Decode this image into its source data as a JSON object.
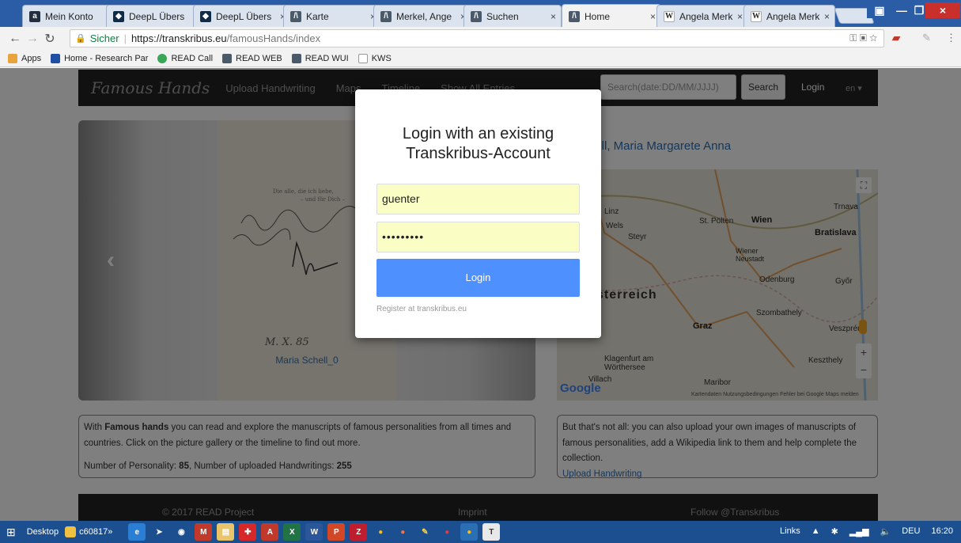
{
  "browser": {
    "tabs": [
      {
        "title": "Mein Konto",
        "icon": "amazon-icon",
        "color": "#232f3e"
      },
      {
        "title": "DeepL Übers",
        "icon": "deepl-icon",
        "color": "#0f2b46"
      },
      {
        "title": "DeepL Übers",
        "icon": "deepl-icon",
        "color": "#0f2b46"
      },
      {
        "title": "Karte",
        "icon": "transkribus-icon",
        "color": "#4a5a6a"
      },
      {
        "title": "Merkel, Ange",
        "icon": "transkribus-icon",
        "color": "#4a5a6a"
      },
      {
        "title": "Suchen",
        "icon": "transkribus-icon",
        "color": "#4a5a6a"
      },
      {
        "title": "Home",
        "icon": "transkribus-icon",
        "color": "#4a5a6a"
      },
      {
        "title": "Angela Merk",
        "icon": "wikipedia-icon",
        "color": "#ffffff"
      },
      {
        "title": "Angela Merk",
        "icon": "wikipedia-icon",
        "color": "#ffffff"
      }
    ],
    "secure_label": "Sicher",
    "url_host": "https://transkribus.eu",
    "url_path": "/famousHands/index",
    "bookmarks": [
      {
        "label": "Apps",
        "color": "#e8a33d"
      },
      {
        "label": "Home - Research Par",
        "color": "#1f4fa3"
      },
      {
        "label": "READ Call",
        "color": "#3aa757"
      },
      {
        "label": "READ WEB",
        "color": "#4a5a6a"
      },
      {
        "label": "READ WUI",
        "color": "#4a5a6a"
      },
      {
        "label": "KWS",
        "color": "#ffffff"
      }
    ]
  },
  "site": {
    "brand": "Famous Hands",
    "nav": [
      "Upload Handwriting",
      "Maps",
      "Timeline",
      "Show All Entries"
    ],
    "search_placeholder": "Search(date:DD/MM/JJJJ)",
    "search_button": "Search",
    "login_link": "Login",
    "lang": "en ▾",
    "carousel_caption": "Maria Schell_0",
    "person_title": "hell, Maria Margarete Anna",
    "info_left": {
      "intro_pre": "With ",
      "intro_bold": "Famous hands",
      "intro_post": " you can read and explore the manuscripts of famous personalities from all times and countries. Click on the picture gallery or the timeline to find out more.",
      "count_pre": "Number of Personality: ",
      "count_persons": "85",
      "count_mid": ", Number of uploaded Handwritings: ",
      "count_hw": "255"
    },
    "info_right": {
      "text": "But that's not all: you can also upload your own images of manuscripts of famous personalities, add a Wikipedia link to them and help complete the collection.",
      "link": "Upload Handwriting"
    },
    "footer": {
      "copyright": "© 2017 READ Project",
      "imprint": "Imprint",
      "follow": "Follow @Transkribus"
    },
    "map_labels": {
      "country": "sterreich",
      "cities": [
        "Linz",
        "Wels",
        "Steyr",
        "St. Pölten",
        "Wien",
        "Bratislava",
        "Trnava",
        "Graz",
        "Klagenfurt am Wörthersee",
        "Villach",
        "Maribor",
        "Szombathely",
        "Győr",
        "Veszprém",
        "Keszthely",
        "Wiener Neustadt",
        "Odenburg"
      ],
      "attribution": "Kartendaten  Nutzungsbedingungen  Fehler bei Google Maps melden",
      "logo": "Google"
    }
  },
  "modal": {
    "title_line1": "Login with an existing",
    "title_line2": "Transkribus-Account",
    "username": "guenter",
    "password_mask": "•••••••••",
    "login_button": "Login",
    "register_text": "Register at transkribus.eu"
  },
  "taskbar": {
    "desktop_label": "Desktop",
    "c_label": "c60817",
    "tray_links": "Links",
    "lang": "DEU",
    "time": "16:20"
  }
}
